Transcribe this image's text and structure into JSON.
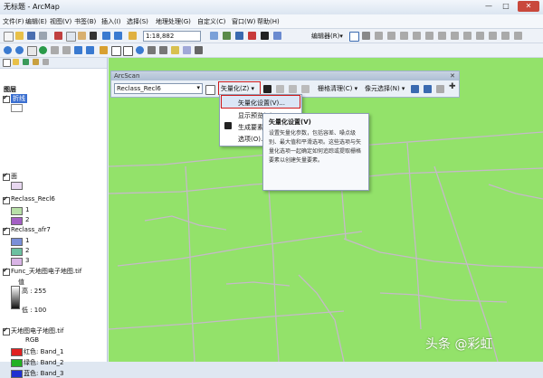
{
  "window": {
    "title": "无标题 - ArcMap",
    "minimize": "—",
    "maximize": "□",
    "close": "✕"
  },
  "menubar": {
    "items": [
      "文件(F)",
      "编辑(E)",
      "视图(V)",
      "书签(B)",
      "插入(I)",
      "选择(S)",
      "地理处理(G)",
      "自定义(C)",
      "窗口(W)",
      "帮助(H)"
    ]
  },
  "toolbar": {
    "scale": "1:18,882",
    "editor_label": "编辑器(R)▾"
  },
  "toc": {
    "root_label": "图层",
    "layers": [
      {
        "name": "折线",
        "selected": true
      },
      {
        "name": "面"
      },
      {
        "name": "Reclass_Recl6",
        "classes": [
          {
            "label": "1",
            "color": "#b8e0a8"
          },
          {
            "label": "2",
            "color": "#a45fc4"
          }
        ]
      },
      {
        "name": "Reclass_afr7",
        "classes": [
          {
            "label": "1",
            "color": "#7a8fd8"
          },
          {
            "label": "2",
            "color": "#6cc0a0"
          },
          {
            "label": "3",
            "color": "#d9b4e6"
          }
        ]
      },
      {
        "name": "Func_天地图电子地图.tif",
        "value_label": "值",
        "high": "高 : 255",
        "low": "低 : 100"
      },
      {
        "name": "天地图电子地图.tif",
        "rgb": "RGB",
        "bands": [
          {
            "label": "红色:  Band_1",
            "color": "#e02020"
          },
          {
            "label": "绿色:  Band_2",
            "color": "#22b022"
          },
          {
            "label": "蓝色:  Band_3",
            "color": "#2030d0"
          }
        ]
      }
    ]
  },
  "arcscan": {
    "title": "ArcScan",
    "layer_select": "Reclass_Recl6",
    "vectorize_menu": "矢量化(Z) ▾",
    "raster_cleanup": "栅格清理(C) ▾",
    "cell_selection": "像元选择(N) ▾"
  },
  "dropdown": {
    "items": [
      "矢量化设置(V)...",
      "显示预览(S)",
      "生成要素(G)...",
      "选项(O)..."
    ]
  },
  "tooltip": {
    "title": "矢量化设置(V)",
    "body": "设置矢量化参数，包括容差、噪点级别、最大值和平滑选项。这些选项与矢量化选项一起确定如何追踪或提取栅格要素以创建矢量要素。"
  },
  "watermark": "头条 @彩虹",
  "colors": {
    "map_fill": "#93e26a",
    "highlight_red": "#d11a1a",
    "selected_blue": "#3b6fd0"
  }
}
